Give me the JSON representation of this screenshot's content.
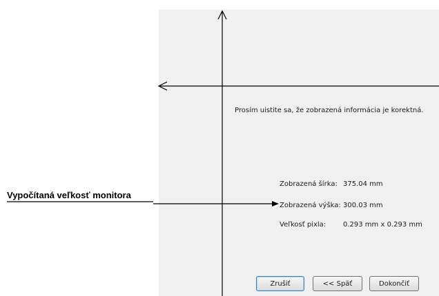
{
  "dialog": {
    "prompt": "Prosím uistite sa, že zobrazená informácia je korektná.",
    "info": {
      "width_label": "Zobrazená šírka:",
      "width_value": "375.04 mm",
      "height_label": "Zobrazená výška:",
      "height_value": "300.03 mm",
      "pixel_label": "Veľkosť pixla:",
      "pixel_value": "0.293 mm x 0.293 mm"
    },
    "buttons": {
      "cancel": "Zrušiť",
      "back": "<< Späť",
      "finish": "Dokončiť"
    }
  },
  "annotation": {
    "label": "Vypočítaná veľkosť monitora"
  },
  "colors": {
    "panel_background": "#f0f0f0",
    "focused_button_border": "#3c7fb1"
  }
}
